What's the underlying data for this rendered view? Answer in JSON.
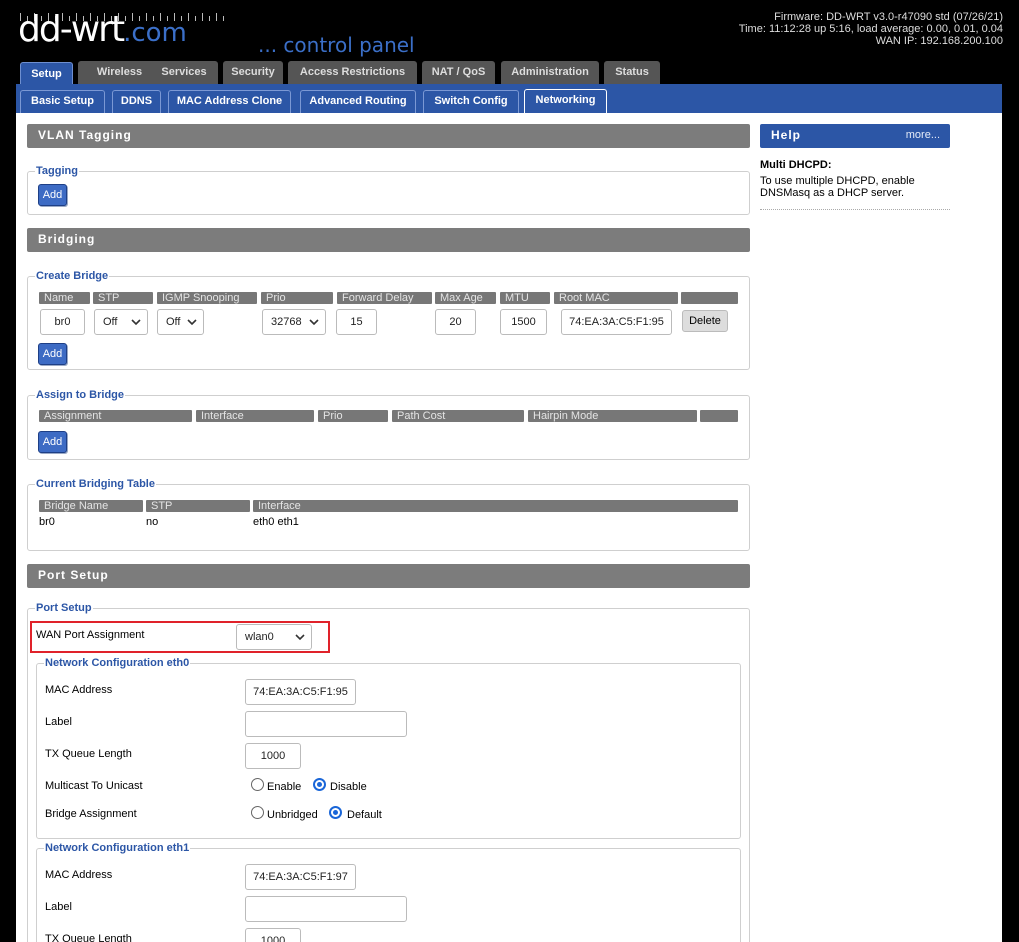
{
  "brand": {
    "name": "dd-wrt",
    "suffix": ".com",
    "tagline": "... control panel"
  },
  "status": {
    "firmware": "Firmware: DD-WRT v3.0-r47090 std (07/26/21)",
    "time": "Time: 11:12:28 up 5:16, load average: 0.00, 0.01, 0.04",
    "wan_ip": "WAN IP: 192.168.200.100"
  },
  "main_tabs": [
    "Setup",
    "Wireless",
    "Services",
    "Security",
    "Access Restrictions",
    "NAT / QoS",
    "Administration",
    "Status"
  ],
  "sub_tabs": [
    "Basic Setup",
    "DDNS",
    "MAC Address Clone",
    "Advanced Routing",
    "Switch Config",
    "Networking"
  ],
  "vlan": {
    "title": "VLAN Tagging",
    "tagging_legend": "Tagging",
    "add_label": "Add"
  },
  "bridging": {
    "title": "Bridging",
    "create_legend": "Create Bridge",
    "create_headers": [
      "Name",
      "STP",
      "IGMP Snooping",
      "Prio",
      "Forward Delay",
      "Max Age",
      "MTU",
      "Root MAC"
    ],
    "row": {
      "name": "br0",
      "stp": "Off",
      "igmp": "Off",
      "prio": "32768",
      "forward_delay": "15",
      "max_age": "20",
      "mtu": "1500",
      "root_mac": "74:EA:3A:C5:F1:95",
      "delete_label": "Delete"
    },
    "add_label": "Add",
    "assign_legend": "Assign to Bridge",
    "assign_headers": [
      "Assignment",
      "Interface",
      "Prio",
      "Path Cost",
      "Hairpin Mode"
    ],
    "assign_add_label": "Add",
    "current_legend": "Current Bridging Table",
    "current_headers": [
      "Bridge Name",
      "STP",
      "Interface"
    ],
    "current_row": {
      "bridge": "br0",
      "stp": "no",
      "interface": "eth0 eth1"
    }
  },
  "port_setup": {
    "title": "Port Setup",
    "legend": "Port Setup",
    "wan_label": "WAN Port Assignment",
    "wan_value": "wlan0",
    "eth0": {
      "legend": "Network Configuration eth0",
      "mac_label": "MAC Address",
      "mac_value": "74:EA:3A:C5:F1:95",
      "label_label": "Label",
      "label_value": "",
      "txq_label": "TX Queue Length",
      "txq_value": "1000",
      "mcast_label": "Multicast To Unicast",
      "mcast_enable": "Enable",
      "mcast_disable": "Disable",
      "bridge_label": "Bridge Assignment",
      "bridge_unbridged": "Unbridged",
      "bridge_default": "Default"
    },
    "eth1": {
      "legend": "Network Configuration eth1",
      "mac_label": "MAC Address",
      "mac_value": "74:EA:3A:C5:F1:97",
      "label_label": "Label",
      "label_value": "",
      "txq_label": "TX Queue Length",
      "txq_value": "1000"
    }
  },
  "help": {
    "title": "Help",
    "more": "more...",
    "heading": "Multi DHCPD:",
    "text": "To use multiple DHCPD, enable DNSMasq as a DHCP server."
  },
  "colors": {
    "accent": "#2c56a6",
    "section_bar": "#7c7c7c",
    "highlight": "#e0222a"
  }
}
